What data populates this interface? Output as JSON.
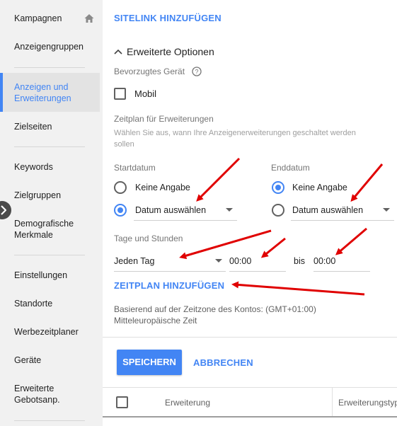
{
  "sidebar": {
    "items": [
      {
        "label": "Kampagnen"
      },
      {
        "label": "Anzeigengruppen"
      },
      {
        "label": "Anzeigen und Erweiterungen"
      },
      {
        "label": "Zielseiten"
      },
      {
        "label": "Keywords"
      },
      {
        "label": "Zielgruppen"
      },
      {
        "label": "Demografische Merkmale"
      },
      {
        "label": "Einstellungen"
      },
      {
        "label": "Standorte"
      },
      {
        "label": "Werbezeitplaner"
      },
      {
        "label": "Geräte"
      },
      {
        "label": "Erweiterte Gebotsanp."
      }
    ],
    "active_index": 2
  },
  "main": {
    "add_sitelink": "SITELINK HINZUFÜGEN",
    "advanced_options": "Erweiterte Optionen",
    "preferred_device_label": "Bevorzugtes Gerät",
    "mobile_label": "Mobil",
    "schedule_title": "Zeitplan für Erweiterungen",
    "schedule_hint": "Wählen Sie aus, wann Ihre Anzeigenerweiterungen geschaltet werden sollen",
    "start": {
      "label": "Startdatum",
      "option_none": "Keine Angabe",
      "option_date": "Datum auswählen",
      "selected": "Datum auswählen"
    },
    "end": {
      "label": "Enddatum",
      "option_none": "Keine Angabe",
      "option_date": "Datum auswählen",
      "selected": "Keine Angabe"
    },
    "days_hours_label": "Tage und Stunden",
    "day_select": "Jeden Tag",
    "time_from": "00:00",
    "bis": "bis",
    "time_to": "00:00",
    "add_schedule": "ZEITPLAN HINZUFÜGEN",
    "timezone_note": "Basierend auf der Zeitzone des Kontos: (GMT+01:00)",
    "timezone_name": "Mitteleuropäische Zeit",
    "save_button": "SPEICHERN",
    "cancel_button": "ABBRECHEN"
  },
  "table": {
    "columns": [
      "Erweiterung",
      "Erweiterungstyp"
    ]
  },
  "colors": {
    "accent": "#4285f4",
    "annotation_arrow": "#e00000",
    "sidebar_bg": "#f1f1f1"
  }
}
